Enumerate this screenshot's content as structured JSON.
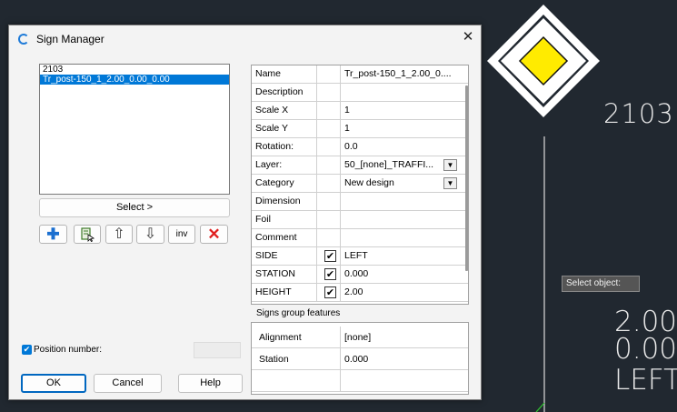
{
  "cad": {
    "sign_number": "2103",
    "height_text": "2.00",
    "station_text": "0.000",
    "side_text": "LEFT",
    "tooltip": "Select object:"
  },
  "dialog": {
    "title": "Sign Manager",
    "close_glyph": "✕",
    "list_items": [
      "2103",
      "Tr_post-150_1_2.00_0.00_0.00"
    ],
    "select_label": "Select >",
    "toolbar": {
      "add_glyph": "✚",
      "pick_glyph": "⧉",
      "up_glyph": "⇧",
      "down_glyph": "⇩",
      "inv_label": "inv",
      "delete_glyph": "✕"
    },
    "position_number_label": "Position number:",
    "buttons": {
      "ok": "OK",
      "cancel": "Cancel",
      "help": "Help"
    },
    "properties": [
      {
        "name": "Name",
        "value": "Tr_post-150_1_2.00_0...."
      },
      {
        "name": "Description",
        "value": ""
      },
      {
        "name": "Scale X",
        "value": "1"
      },
      {
        "name": "Scale Y",
        "value": "1"
      },
      {
        "name": "Rotation:",
        "value": "0.0"
      },
      {
        "name": "Layer:",
        "value": "50_[none]_TRAFFI..."
      },
      {
        "name": "Category",
        "value": "New design"
      },
      {
        "name": "Dimension",
        "value": ""
      },
      {
        "name": "Foil",
        "value": ""
      },
      {
        "name": "Comment",
        "value": ""
      },
      {
        "name": "SIDE",
        "value": "LEFT"
      },
      {
        "name": "STATION",
        "value": "0.000"
      },
      {
        "name": "HEIGHT",
        "value": "2.00"
      }
    ],
    "check_glyph": "✔",
    "dropdown_glyph": "▼",
    "group_title": "Signs group features",
    "group_rows": [
      {
        "name": "Alignment",
        "value": "[none]"
      },
      {
        "name": "Station",
        "value": "0.000"
      },
      {
        "name": "",
        "value": ""
      }
    ]
  },
  "colors": {
    "accent": "#0078d7",
    "sign_yellow": "#ffeb00",
    "cad_background": "#212830"
  }
}
